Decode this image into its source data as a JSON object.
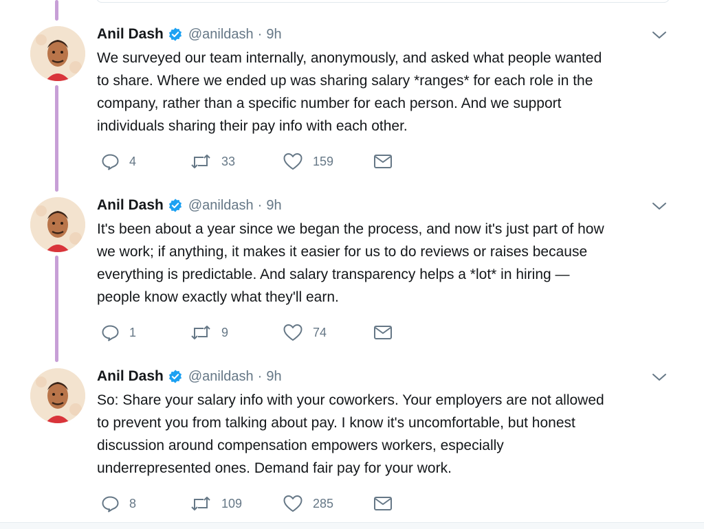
{
  "tweets": [
    {
      "author": "Anil Dash",
      "handle": "@anildash",
      "separator": "·",
      "time": "9h",
      "text": "We surveyed our team internally, anonymously, and asked what people wanted\nto share. Where we ended up was sharing salary *ranges* for each role in the\ncompany, rather than a specific number for each person. And we support\nindividuals sharing their pay info with each other.",
      "replies": "4",
      "retweets": "33",
      "likes": "159"
    },
    {
      "author": "Anil Dash",
      "handle": "@anildash",
      "separator": "·",
      "time": "9h",
      "text": "It's been about a year since we began the process, and now it's just part of how\nwe work; if anything, it makes it easier for us to do reviews or raises because\neverything is predictable. And salary transparency helps a *lot* in hiring —\npeople know exactly what they'll earn.",
      "replies": "1",
      "retweets": "9",
      "likes": "74"
    },
    {
      "author": "Anil Dash",
      "handle": "@anildash",
      "separator": "·",
      "time": "9h",
      "text": "So: Share your salary info with your coworkers. Your employers are not allowed\nto prevent you from talking about pay. I know it's uncomfortable, but honest\ndiscussion around compensation empowers workers, especially\nunderrepresented ones. Demand fair pay for your work.",
      "replies": "8",
      "retweets": "109",
      "likes": "285"
    }
  ],
  "colors": {
    "thread_line": "#c79fd6",
    "verified": "#1da1f2",
    "secondary_text": "#657786",
    "primary_text": "#14171a"
  },
  "icons": {
    "reply": "reply-icon",
    "retweet": "retweet-icon",
    "like": "heart-icon",
    "message": "envelope-icon",
    "verified": "verified-badge-icon",
    "menu": "chevron-down-icon"
  }
}
